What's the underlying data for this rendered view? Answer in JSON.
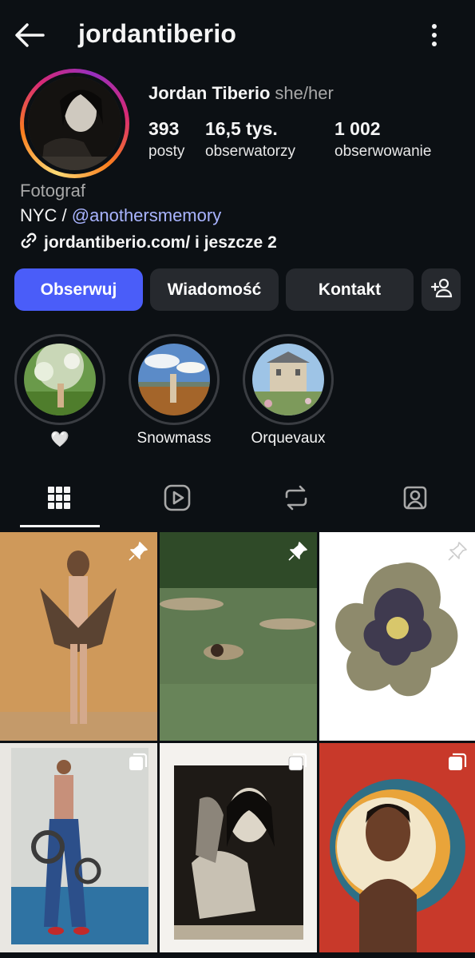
{
  "header": {
    "username": "jordantiberio",
    "back_icon": "arrow-left-icon",
    "more_icon": "more-vertical-icon"
  },
  "profile": {
    "display_name": "Jordan Tiberio",
    "pronouns": "she/her",
    "stats": [
      {
        "value": "393",
        "label": "posty"
      },
      {
        "value": "16,5 tys.",
        "label": "obserwatorzy"
      },
      {
        "value": "1 002",
        "label": "obserwowanie"
      }
    ],
    "category": "Fotograf",
    "bio_prefix": "NYC / ",
    "bio_mention": "@anothersmemory",
    "link_text": "jordantiberio.com/ i jeszcze 2"
  },
  "actions": {
    "follow": "Obserwuj",
    "message": "Wiadomość",
    "contact": "Kontakt",
    "add_user_icon": "add-person-icon"
  },
  "highlights": [
    {
      "label": "🤍"
    },
    {
      "label": "Snowmass"
    },
    {
      "label": "Orquevaux"
    }
  ],
  "tabs": [
    "grid-icon",
    "reels-icon",
    "reposts-icon",
    "tagged-icon"
  ],
  "posts": [
    {
      "badge": "pin-icon"
    },
    {
      "badge": "pin-icon"
    },
    {
      "badge": "pin-icon"
    },
    {
      "badge": "carousel-icon"
    },
    {
      "badge": "carousel-icon"
    },
    {
      "badge": "carousel-icon"
    }
  ],
  "colors": {
    "background": "#0c1014",
    "primary_button": "#4a5df9",
    "secondary_button": "#26292e",
    "mention": "#a9b4ff"
  }
}
